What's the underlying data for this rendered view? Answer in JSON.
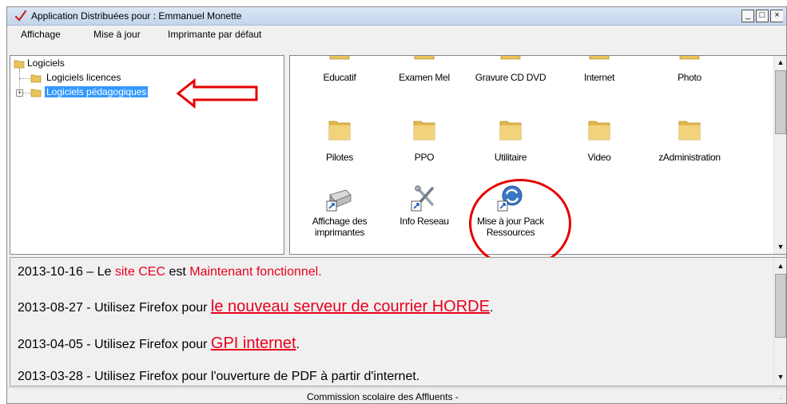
{
  "window": {
    "title": "Application Distribuées pour : Emmanuel Monette",
    "controls": [
      "_",
      "□",
      "×"
    ]
  },
  "menu": [
    "Affichage",
    "Mise à jour",
    "Imprimante par défaut"
  ],
  "tree": {
    "root": "Logiciels",
    "children": [
      "Logiciels licences",
      "Logiciels pédagogiques"
    ],
    "selected_index": 1
  },
  "icons": {
    "row1": [
      "Educatif",
      "Examen Mel",
      "Gravure CD DVD",
      "Internet",
      "Photo"
    ],
    "row2": [
      "Pilotes",
      "PPO",
      "Utilitaire",
      "Video",
      "zAdministration"
    ],
    "row3": [
      {
        "line1": "Affichage des",
        "line2": "imprimantes",
        "icon": "printer-shortcut-icon"
      },
      {
        "line1": "Info Reseau",
        "line2": "",
        "icon": "tools-shortcut-icon"
      },
      {
        "line1": "Mise à jour Pack",
        "line2": "Ressources",
        "icon": "update-shortcut-icon"
      }
    ]
  },
  "news": [
    {
      "date": "2013-10-16 – Le ",
      "r1": "site CEC",
      "mid": " est ",
      "r2": "Maintenant fonctionnel."
    },
    {
      "prefix": "2013-08-27 - Utilisez Firefox pour ",
      "link": "le nouveau serveur de courrier HORDE",
      "suffix": "."
    },
    {
      "prefix": "2013-04-05 - Utilisez Firefox pour ",
      "link": "GPI internet",
      "suffix": "."
    },
    {
      "text": "2013-03-28 - Utilisez Firefox pour l'ouverture de PDF à partir d'internet."
    }
  ],
  "status": "Commission scolaire des Affluents -",
  "colors": {
    "accent_red": "#e8001c",
    "selection": "#3399ff",
    "folder": "#e8c25b"
  }
}
